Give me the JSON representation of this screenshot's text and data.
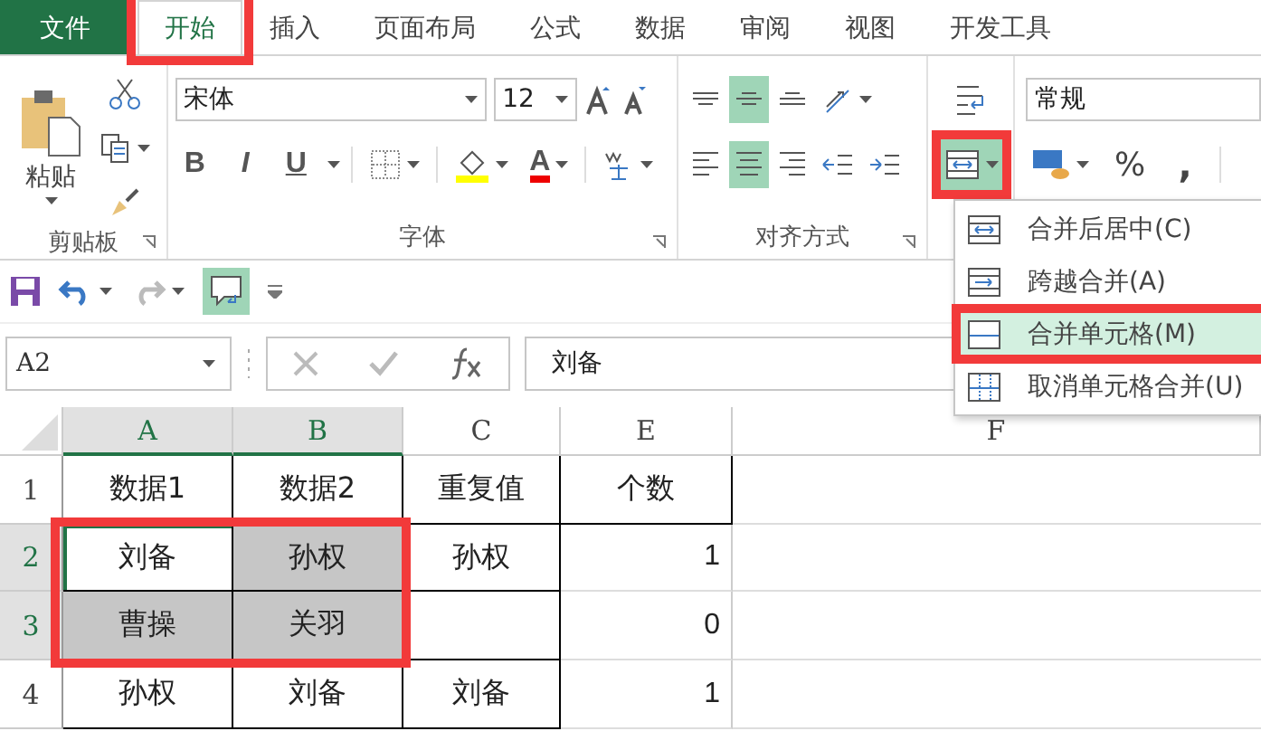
{
  "tabs": [
    {
      "label": "文件",
      "kind": "file",
      "selected": false,
      "annotated": false
    },
    {
      "label": "开始",
      "kind": "tab",
      "selected": true,
      "annotated": true
    },
    {
      "label": "插入",
      "kind": "tab",
      "selected": false,
      "annotated": false
    },
    {
      "label": "页面布局",
      "kind": "tab",
      "selected": false,
      "annotated": false
    },
    {
      "label": "公式",
      "kind": "tab",
      "selected": false,
      "annotated": false
    },
    {
      "label": "数据",
      "kind": "tab",
      "selected": false,
      "annotated": false
    },
    {
      "label": "审阅",
      "kind": "tab",
      "selected": false,
      "annotated": false
    },
    {
      "label": "视图",
      "kind": "tab",
      "selected": false,
      "annotated": false
    },
    {
      "label": "开发工具",
      "kind": "tab",
      "selected": false,
      "annotated": false
    }
  ],
  "ribbon": {
    "clipboard": {
      "paste_label": "粘贴",
      "group_label": "剪贴板"
    },
    "font": {
      "font_name": "宋体",
      "font_size": "12",
      "group_label": "字体",
      "bold": "B",
      "italic": "I",
      "underline": "U",
      "font_color": "A"
    },
    "alignment": {
      "group_label": "对齐方式",
      "vertical": [
        {
          "kind": "top",
          "selected": false
        },
        {
          "kind": "middle",
          "selected": true
        },
        {
          "kind": "bottom",
          "selected": false
        }
      ],
      "horizontal": [
        {
          "kind": "left",
          "selected": false
        },
        {
          "kind": "center",
          "selected": true
        },
        {
          "kind": "right",
          "selected": false
        }
      ]
    },
    "merge_button": {
      "selected": true,
      "annotated": true
    },
    "number": {
      "format": "常规",
      "percent": "%",
      "comma": ","
    }
  },
  "quick_access": {
    "comment_selected": true
  },
  "formula_bar": {
    "name_box": "A2",
    "formula": "刘备"
  },
  "merge_menu": [
    {
      "label": "合并后居中(C)",
      "kind": "center",
      "selected": false,
      "annotated": false
    },
    {
      "label": "跨越合并(A)",
      "kind": "across",
      "selected": false,
      "annotated": false
    },
    {
      "label": "合并单元格(M)",
      "kind": "merge",
      "selected": true,
      "annotated": true
    },
    {
      "label": "取消单元格合并(U)",
      "kind": "unmerge",
      "selected": false,
      "annotated": false
    }
  ],
  "sheet": {
    "columns": [
      {
        "label": "A",
        "selected": true
      },
      {
        "label": "B",
        "selected": true
      },
      {
        "label": "C",
        "selected": false
      },
      {
        "label": "E",
        "selected": false
      },
      {
        "label": "F",
        "selected": false
      }
    ],
    "rows": [
      {
        "label": "1",
        "selected": false,
        "cells": [
          {
            "text": "数据1",
            "selected": false
          },
          {
            "text": "数据2",
            "selected": false
          },
          {
            "text": "重复值",
            "selected": false
          },
          {
            "text": "个数",
            "selected": false
          }
        ]
      },
      {
        "label": "2",
        "selected": true,
        "cells": [
          {
            "text": "刘备",
            "selected": false,
            "active": true,
            "annotated": true
          },
          {
            "text": "孙权",
            "selected": true,
            "annotated": true
          },
          {
            "text": "孙权",
            "selected": false
          },
          {
            "text": "1",
            "selected": false,
            "kind": "number"
          }
        ]
      },
      {
        "label": "3",
        "selected": true,
        "cells": [
          {
            "text": "曹操",
            "selected": true,
            "annotated": true
          },
          {
            "text": "关羽",
            "selected": true,
            "annotated": true
          },
          {
            "text": "",
            "selected": false
          },
          {
            "text": "0",
            "selected": false,
            "kind": "number"
          }
        ]
      },
      {
        "label": "4",
        "selected": false,
        "cells": [
          {
            "text": "孙权",
            "selected": false
          },
          {
            "text": "刘备",
            "selected": false
          },
          {
            "text": "刘备",
            "selected": false
          },
          {
            "text": "1",
            "selected": false,
            "kind": "number"
          }
        ]
      }
    ]
  }
}
